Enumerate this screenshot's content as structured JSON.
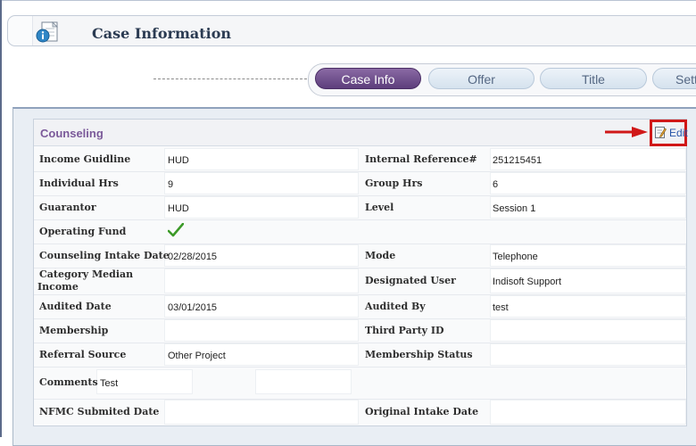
{
  "header": {
    "title": "Case Information",
    "icon": "case-info-icon"
  },
  "tabs": [
    {
      "label": "Case Info",
      "active": true
    },
    {
      "label": "Offer",
      "active": false
    },
    {
      "label": "Title",
      "active": false
    },
    {
      "label": "Sett",
      "active": false
    }
  ],
  "section": {
    "title": "Counseling",
    "edit_label": "Edit",
    "accent_color": "#7b5a9a",
    "highlight_color": "#d01818"
  },
  "fields": {
    "income_guidline": {
      "label": "Income Guidline",
      "value": "HUD"
    },
    "internal_reference": {
      "label": "Internal Reference#",
      "value": "251215451"
    },
    "individual_hrs": {
      "label": "Individual Hrs",
      "value": "9"
    },
    "group_hrs": {
      "label": "Group Hrs",
      "value": "6"
    },
    "guarantor": {
      "label": "Guarantor",
      "value": "HUD"
    },
    "level": {
      "label": "Level",
      "value": "Session 1"
    },
    "operating_fund": {
      "label": "Operating Fund",
      "checked": true
    },
    "counseling_intake_date": {
      "label": "Counseling Intake Date",
      "value": "02/28/2015"
    },
    "mode": {
      "label": "Mode",
      "value": "Telephone"
    },
    "category_median_income": {
      "label_line1": "Category Median",
      "label_line2": "Income",
      "value": ""
    },
    "designated_user": {
      "label": "Designated User",
      "value": "Indisoft Support"
    },
    "audited_date": {
      "label": "Audited Date",
      "value": "03/01/2015"
    },
    "audited_by": {
      "label": "Audited By",
      "value": "test"
    },
    "membership": {
      "label": "Membership",
      "value": ""
    },
    "third_party_id": {
      "label": "Third Party ID",
      "value": ""
    },
    "referral_source": {
      "label": "Referral Source",
      "value": "Other Project"
    },
    "membership_status": {
      "label": "Membership Status",
      "value": ""
    },
    "comments": {
      "label": "Comments",
      "value": "Test"
    },
    "nfmc_submited_date": {
      "label": "NFMC Submited Date",
      "value": ""
    },
    "original_intake_date": {
      "label": "Original Intake Date",
      "value": ""
    }
  }
}
